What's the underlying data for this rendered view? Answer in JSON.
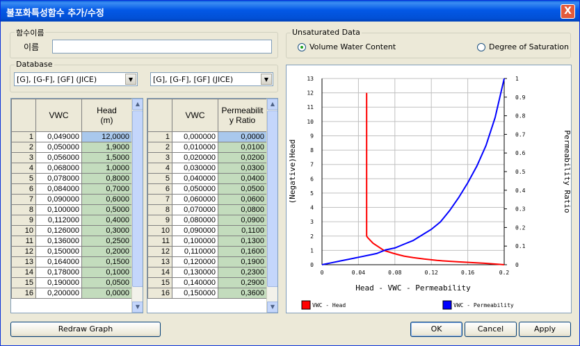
{
  "window": {
    "title": "불포화특성함수 추가/수정",
    "close_glyph": "X"
  },
  "name_group": {
    "label": "함수이름",
    "field_label": "이름",
    "value": ""
  },
  "database": {
    "label": "Database",
    "combo_left": "[G], [G-F], [GF] (JICE)",
    "combo_right": "[G], [G-F], [GF] (JICE)"
  },
  "unsaturated": {
    "label": "Unsaturated Data",
    "opt1": "Volume Water Content",
    "opt2": "Degree of Saturation",
    "selected": "opt1"
  },
  "left_table": {
    "col1": "VWC",
    "col2": "Head\n(m)",
    "rows": [
      [
        "1",
        "0,049000",
        "12,0000"
      ],
      [
        "2",
        "0,050000",
        "1,9000"
      ],
      [
        "3",
        "0,056000",
        "1,5000"
      ],
      [
        "4",
        "0,068000",
        "1,0000"
      ],
      [
        "5",
        "0,078000",
        "0,8000"
      ],
      [
        "6",
        "0,084000",
        "0,7000"
      ],
      [
        "7",
        "0,090000",
        "0,6000"
      ],
      [
        "8",
        "0,100000",
        "0,5000"
      ],
      [
        "9",
        "0,112000",
        "0,4000"
      ],
      [
        "10",
        "0,126000",
        "0,3000"
      ],
      [
        "11",
        "0,136000",
        "0,2500"
      ],
      [
        "12",
        "0,150000",
        "0,2000"
      ],
      [
        "13",
        "0,164000",
        "0,1500"
      ],
      [
        "14",
        "0,178000",
        "0,1000"
      ],
      [
        "15",
        "0,190000",
        "0,0500"
      ],
      [
        "16",
        "0,200000",
        "0,0000"
      ]
    ]
  },
  "right_table": {
    "col1": "VWC",
    "col2": "Permeabilit\ny Ratio",
    "rows": [
      [
        "1",
        "0,000000",
        "0,0000"
      ],
      [
        "2",
        "0,010000",
        "0,0100"
      ],
      [
        "3",
        "0,020000",
        "0,0200"
      ],
      [
        "4",
        "0,030000",
        "0,0300"
      ],
      [
        "5",
        "0,040000",
        "0,0400"
      ],
      [
        "6",
        "0,050000",
        "0,0500"
      ],
      [
        "7",
        "0,060000",
        "0,0600"
      ],
      [
        "8",
        "0,070000",
        "0,0800"
      ],
      [
        "9",
        "0,080000",
        "0,0900"
      ],
      [
        "10",
        "0,090000",
        "0,1100"
      ],
      [
        "11",
        "0,100000",
        "0,1300"
      ],
      [
        "12",
        "0,110000",
        "0,1600"
      ],
      [
        "13",
        "0,120000",
        "0,1900"
      ],
      [
        "14",
        "0,130000",
        "0,2300"
      ],
      [
        "15",
        "0,140000",
        "0,2900"
      ],
      [
        "16",
        "0,150000",
        "0,3600"
      ]
    ]
  },
  "chart_data": {
    "type": "line",
    "xlabel": "Head - VWC - Permeability",
    "ylabel_left": "(Negative)Head",
    "ylabel_right": "Permeability Ratio",
    "x_ticks": [
      "0",
      "0.04",
      "0.08",
      "0.12",
      "0.16",
      "0.2"
    ],
    "xlim": [
      0,
      0.2
    ],
    "y_left_ticks": [
      "0",
      "1",
      "2",
      "3",
      "4",
      "5",
      "6",
      "7",
      "8",
      "9",
      "10",
      "11",
      "12",
      "13"
    ],
    "ylim_left": [
      0,
      13
    ],
    "y_right_ticks": [
      "0",
      "0.1",
      "0.2",
      "0.3",
      "0.4",
      "0.5",
      "0.6",
      "0.7",
      "0.8",
      "0.9",
      "1"
    ],
    "ylim_right": [
      0,
      1
    ],
    "grid": true,
    "legend_position": "bottom",
    "series": [
      {
        "name": "VWC - Head",
        "color": "#ff0000",
        "axis": "left",
        "x": [
          0.049,
          0.049,
          0.05,
          0.056,
          0.068,
          0.078,
          0.084,
          0.09,
          0.1,
          0.112,
          0.126,
          0.136,
          0.15,
          0.164,
          0.178,
          0.19,
          0.2
        ],
        "y": [
          12.0,
          2.0,
          1.9,
          1.5,
          1.0,
          0.8,
          0.7,
          0.6,
          0.5,
          0.4,
          0.3,
          0.25,
          0.2,
          0.15,
          0.1,
          0.05,
          0.0
        ]
      },
      {
        "name": "VWC - Permeability",
        "color": "#0000ff",
        "axis": "right",
        "x": [
          0,
          0.01,
          0.02,
          0.03,
          0.04,
          0.05,
          0.06,
          0.07,
          0.08,
          0.09,
          0.1,
          0.11,
          0.12,
          0.13,
          0.14,
          0.15,
          0.16,
          0.17,
          0.18,
          0.19,
          0.2
        ],
        "y": [
          0,
          0.01,
          0.02,
          0.03,
          0.04,
          0.05,
          0.06,
          0.08,
          0.09,
          0.11,
          0.13,
          0.16,
          0.19,
          0.23,
          0.29,
          0.36,
          0.44,
          0.53,
          0.64,
          0.79,
          1.0
        ]
      }
    ]
  },
  "buttons": {
    "redraw": "Redraw Graph",
    "ok": "OK",
    "cancel": "Cancel",
    "apply": "Apply"
  }
}
